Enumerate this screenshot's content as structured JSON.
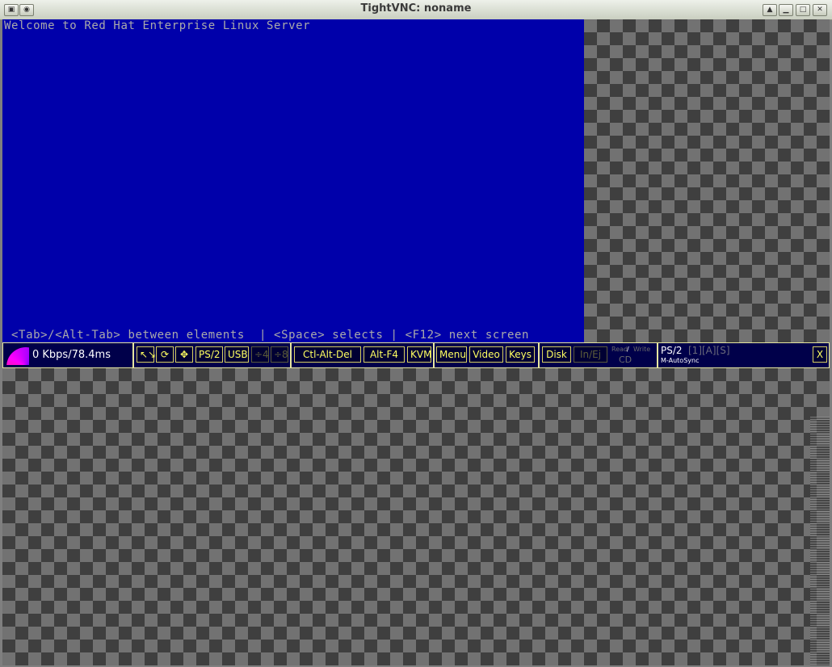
{
  "window": {
    "title": "TightVNC: noname",
    "controls": [
      "menu-icon",
      "pin-icon",
      "shade-icon",
      "minimize-icon",
      "maximize-icon",
      "close-icon"
    ]
  },
  "console": {
    "header": "Welcome to Red Hat Enterprise Linux Server",
    "footer": " <Tab>/<Alt-Tab> between elements  | <Space> selects | <F12> next screen",
    "background": "#0000aa",
    "text_color": "#aaaaaa"
  },
  "kvm_toolbar": {
    "rate": "0 Kbps/78.4ms",
    "mouse_buttons": {
      "scale": "↖↘",
      "refresh": "⟳",
      "move": "✥"
    },
    "ps2": "PS/2",
    "usb": "USB",
    "x4": "÷4",
    "x8": "÷8",
    "ctl_alt_del": "Ctl-Alt-Del",
    "alt_f4": "Alt-F4",
    "kvm": "KVM",
    "menu": "Menu",
    "video": "Video",
    "keys": "Keys",
    "disk": "Disk",
    "in_ej": "In/Ej",
    "read": "Read",
    "write": "Write",
    "cd": "CD",
    "ps2_status": "PS/2",
    "ps2_flags": "[1][A][S]",
    "autosync": "M-AutoSync",
    "close": "X",
    "accent": "#ffff60"
  }
}
